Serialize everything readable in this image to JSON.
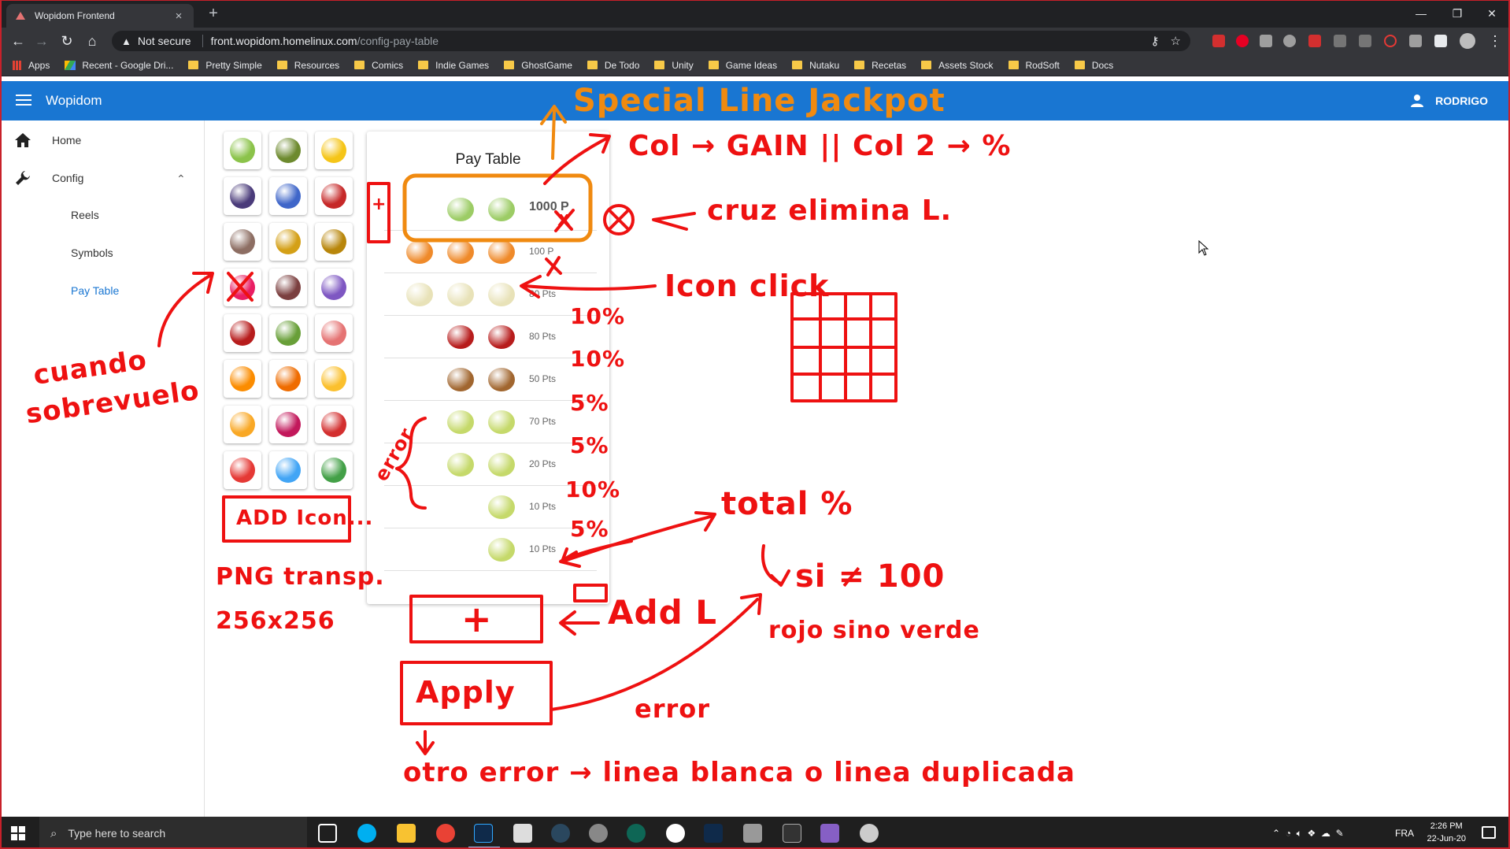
{
  "browser": {
    "tab_title": "Wopidom Frontend",
    "tab_close": "×",
    "new_tab": "+",
    "window_controls": [
      "—",
      "❐",
      "✕"
    ],
    "security_label": "Not secure",
    "url_host": "front.wopidom.homelinux.com",
    "url_path": "/config-pay-table",
    "bookmarks": [
      "Apps",
      "Recent - Google Dri...",
      "Pretty Simple",
      "Resources",
      "Comics",
      "Indie Games",
      "GhostGame",
      "De Todo",
      "Unity",
      "Game Ideas",
      "Nutaku",
      "Recetas",
      "Assets Stock",
      "RodSoft",
      "Docs"
    ]
  },
  "app": {
    "name": "Wopidom",
    "user": "RODRIGO"
  },
  "sidebar": {
    "home": "Home",
    "config": "Config",
    "sub": [
      "Reels",
      "Symbols",
      "Pay Table"
    ],
    "active": "Pay Table"
  },
  "symbols": [
    {
      "icon": "apple-icon",
      "color": "#8bc34a"
    },
    {
      "icon": "avocado-icon",
      "color": "#6d8a2e"
    },
    {
      "icon": "banana-icon",
      "color": "#f5c518"
    },
    {
      "icon": "blackberry-icon",
      "color": "#4a3b7a"
    },
    {
      "icon": "blueberry-icon",
      "color": "#3f66c9"
    },
    {
      "icon": "cherry-icon",
      "color": "#c62828"
    },
    {
      "icon": "coconut-icon",
      "color": "#8d6e63"
    },
    {
      "icon": "coin-icon",
      "color": "#d4a017"
    },
    {
      "icon": "bag-icon",
      "color": "#b8860b"
    },
    {
      "icon": "dragonfruit-icon",
      "color": "#e91e63"
    },
    {
      "icon": "fig-icon",
      "color": "#7b3f3f"
    },
    {
      "icon": "grapes-icon",
      "color": "#7e57c2"
    },
    {
      "icon": "jackpot-icon",
      "color": "#b71c1c"
    },
    {
      "icon": "kiwi-icon",
      "color": "#689f38"
    },
    {
      "icon": "lychee-icon",
      "color": "#e57373"
    },
    {
      "icon": "orange-icon",
      "color": "#fb8c00"
    },
    {
      "icon": "papaya-icon",
      "color": "#ef6c00"
    },
    {
      "icon": "pear-icon",
      "color": "#fbc02d"
    },
    {
      "icon": "pineapple-icon",
      "color": "#f9a825"
    },
    {
      "icon": "pomegranate-icon",
      "color": "#c2185b"
    },
    {
      "icon": "seven-icon",
      "color": "#d32f2f"
    },
    {
      "icon": "strawberry-icon",
      "color": "#e53935"
    },
    {
      "icon": "cards-icon",
      "color": "#42a5f5"
    },
    {
      "icon": "watermelon-icon",
      "color": "#43a047"
    }
  ],
  "pay_table": {
    "title": "Pay Table",
    "rows": [
      {
        "icons": [
          "apple-icon",
          "apple-icon"
        ],
        "color": "#9ccc65",
        "points": "1000 P",
        "highlight": true
      },
      {
        "icons": [
          "cat-icon",
          "cat-icon",
          "cat-icon"
        ],
        "color": "#ef8a2a",
        "points": "100 P"
      },
      {
        "icons": [
          "egg-icon",
          "egg-icon",
          "egg-icon"
        ],
        "color": "#e8e2b8",
        "points": "80 Pts"
      },
      {
        "icons": [
          "berries-icon",
          "berries-icon"
        ],
        "color": "#b71c1c",
        "points": "80 Pts"
      },
      {
        "icons": [
          "mushroom-icon",
          "mushroom-icon"
        ],
        "color": "#a1662f",
        "points": "50 Pts"
      },
      {
        "icons": [
          "plate-icon",
          "plate-icon"
        ],
        "color": "#c5d96a",
        "points": "70 Pts"
      },
      {
        "icons": [
          "plate-icon",
          "plate-icon"
        ],
        "color": "#c5d96a",
        "points": "20 Pts"
      },
      {
        "icons": [
          "plate-icon"
        ],
        "color": "#c5d96a",
        "points": "10 Pts"
      },
      {
        "icons": [
          "plate-icon"
        ],
        "color": "#c5d96a",
        "points": "10 Pts"
      }
    ]
  },
  "annotations": {
    "special_line": "Special Line Jackpot",
    "col_gain": "Col → GAIN || Col 2 → %",
    "cruz": "cruz elimina L.",
    "icon_click": "Icon click",
    "cuando": "cuando",
    "sobrevuelo": "sobrevuelo",
    "error_brace": "error",
    "percents": [
      "10%",
      "10%",
      "5%",
      "5%",
      "10%",
      "5%"
    ],
    "add_icon": "ADD Icon...",
    "png": "PNG transp.",
    "size": "256x256",
    "total": "total %",
    "si": "si ≠ 100",
    "rojo": "rojo sino verde",
    "add_l": "Add L",
    "plus": "+",
    "apply": "Apply",
    "error": "error",
    "otro": "otro error → linea blanca o linea duplicada",
    "row_plus": "+",
    "row_x": "x"
  },
  "taskbar": {
    "search_placeholder": "Type here to search",
    "lang": "FRA",
    "time": "2:26 PM",
    "date": "22-Jun-20"
  }
}
